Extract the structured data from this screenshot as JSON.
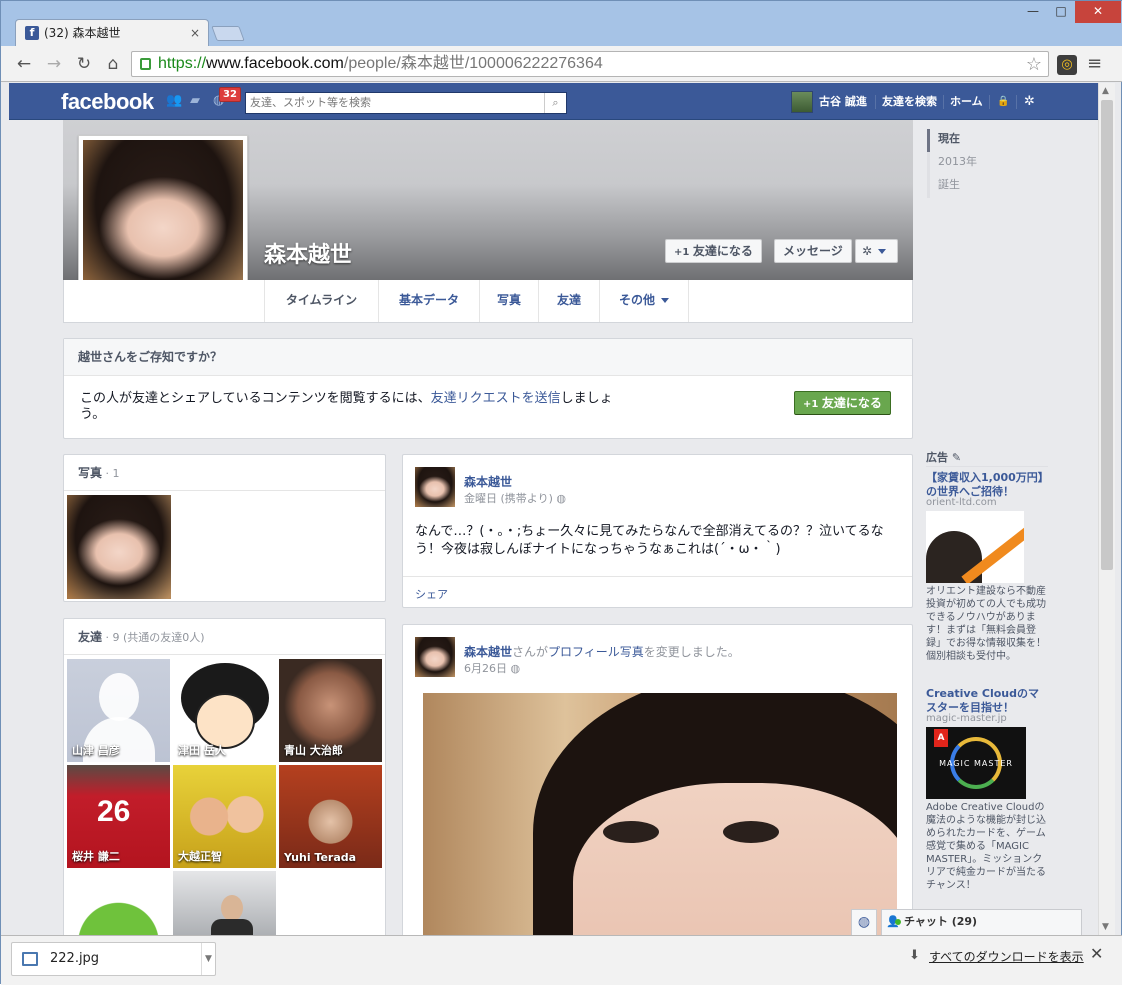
{
  "browser": {
    "tab_title": "(32) 森本越世",
    "tab_close": "×",
    "favicon": "f",
    "url_scheme": "https://",
    "url_host": "www.facebook.com",
    "url_path": "/people/森本越世/100006222276364",
    "window_min": "—",
    "window_max": "□",
    "window_close": "✕"
  },
  "fb_header": {
    "logo": "facebook",
    "notification_count": "32",
    "search_placeholder": "友達、スポット等を検索",
    "user_name": "古谷 誠進",
    "find_friends": "友達を検索",
    "home": "ホーム"
  },
  "profile": {
    "name": "森本越世",
    "add_friend_button": "友達になる",
    "message_button": "メッセージ",
    "tabs": [
      "タイムライン",
      "基本データ",
      "写真",
      "友達",
      "その他"
    ]
  },
  "timeline_years": [
    "現在",
    "2013年",
    "誕生"
  ],
  "know_box": {
    "title": "越世さんをご存知ですか？",
    "text_before": "この人が友達とシェアしているコンテンツを閲覧するには、",
    "link": "友達リクエストを送信",
    "text_after": "しましょう。",
    "button": "友達になる"
  },
  "photos_box": {
    "title": "写真",
    "count": " · 1"
  },
  "friends_box": {
    "title": "友達",
    "count": " · 9 (共通の友達0人)",
    "friends": [
      "山津 昌彦",
      "津田 岳人",
      "青山 大治郎",
      "桜井 謙二",
      "大越正智",
      "Yuhi Terada"
    ]
  },
  "post1": {
    "author": "森本越世",
    "meta": "金曜日 (携帯より)",
    "text": "なんで…？(・。・;ちょー久々に見てみたらなんで全部消えてるの？？泣いてるなう！今夜は寂しんぼナイトになっちゃうなぁこれは(´・ω・｀)",
    "share": "シェア"
  },
  "post2": {
    "author": "森本越世",
    "action_before": "さんが",
    "action_link": "プロフィール写真",
    "action_after": "を変更しました。",
    "meta": "6月26日"
  },
  "ads": {
    "label": "広告",
    "ad1": {
      "title": "【家賃収入1,000万円】の世界へご招待！",
      "domain": "orient-ltd.com",
      "body": "オリエント建設なら不動産投資が初めての人でも成功できるノウハウがあります！まずは「無料会員登録」でお得な情報収集を！ 個別相談も受付中。"
    },
    "ad2": {
      "title": "Creative Cloudのマスターを目指せ！",
      "domain": "magic-master.jp",
      "image_text": "MAGIC MASTER",
      "body": "Adobe Creative Cloudの魔法のような機能が封じ込められたカードを、ゲーム感覚で集める「MAGIC MASTER」。ミッションクリアで純金カードが当たるチャンス！"
    }
  },
  "chat": {
    "label": "チャット (29)"
  },
  "downloads": {
    "file": "222.jpg",
    "show_all": "すべてのダウンロードを表示",
    "close": "✕"
  },
  "colors": {
    "brand": "#3b5998",
    "green": "#69a74e",
    "badge": "#dd3c3c"
  }
}
